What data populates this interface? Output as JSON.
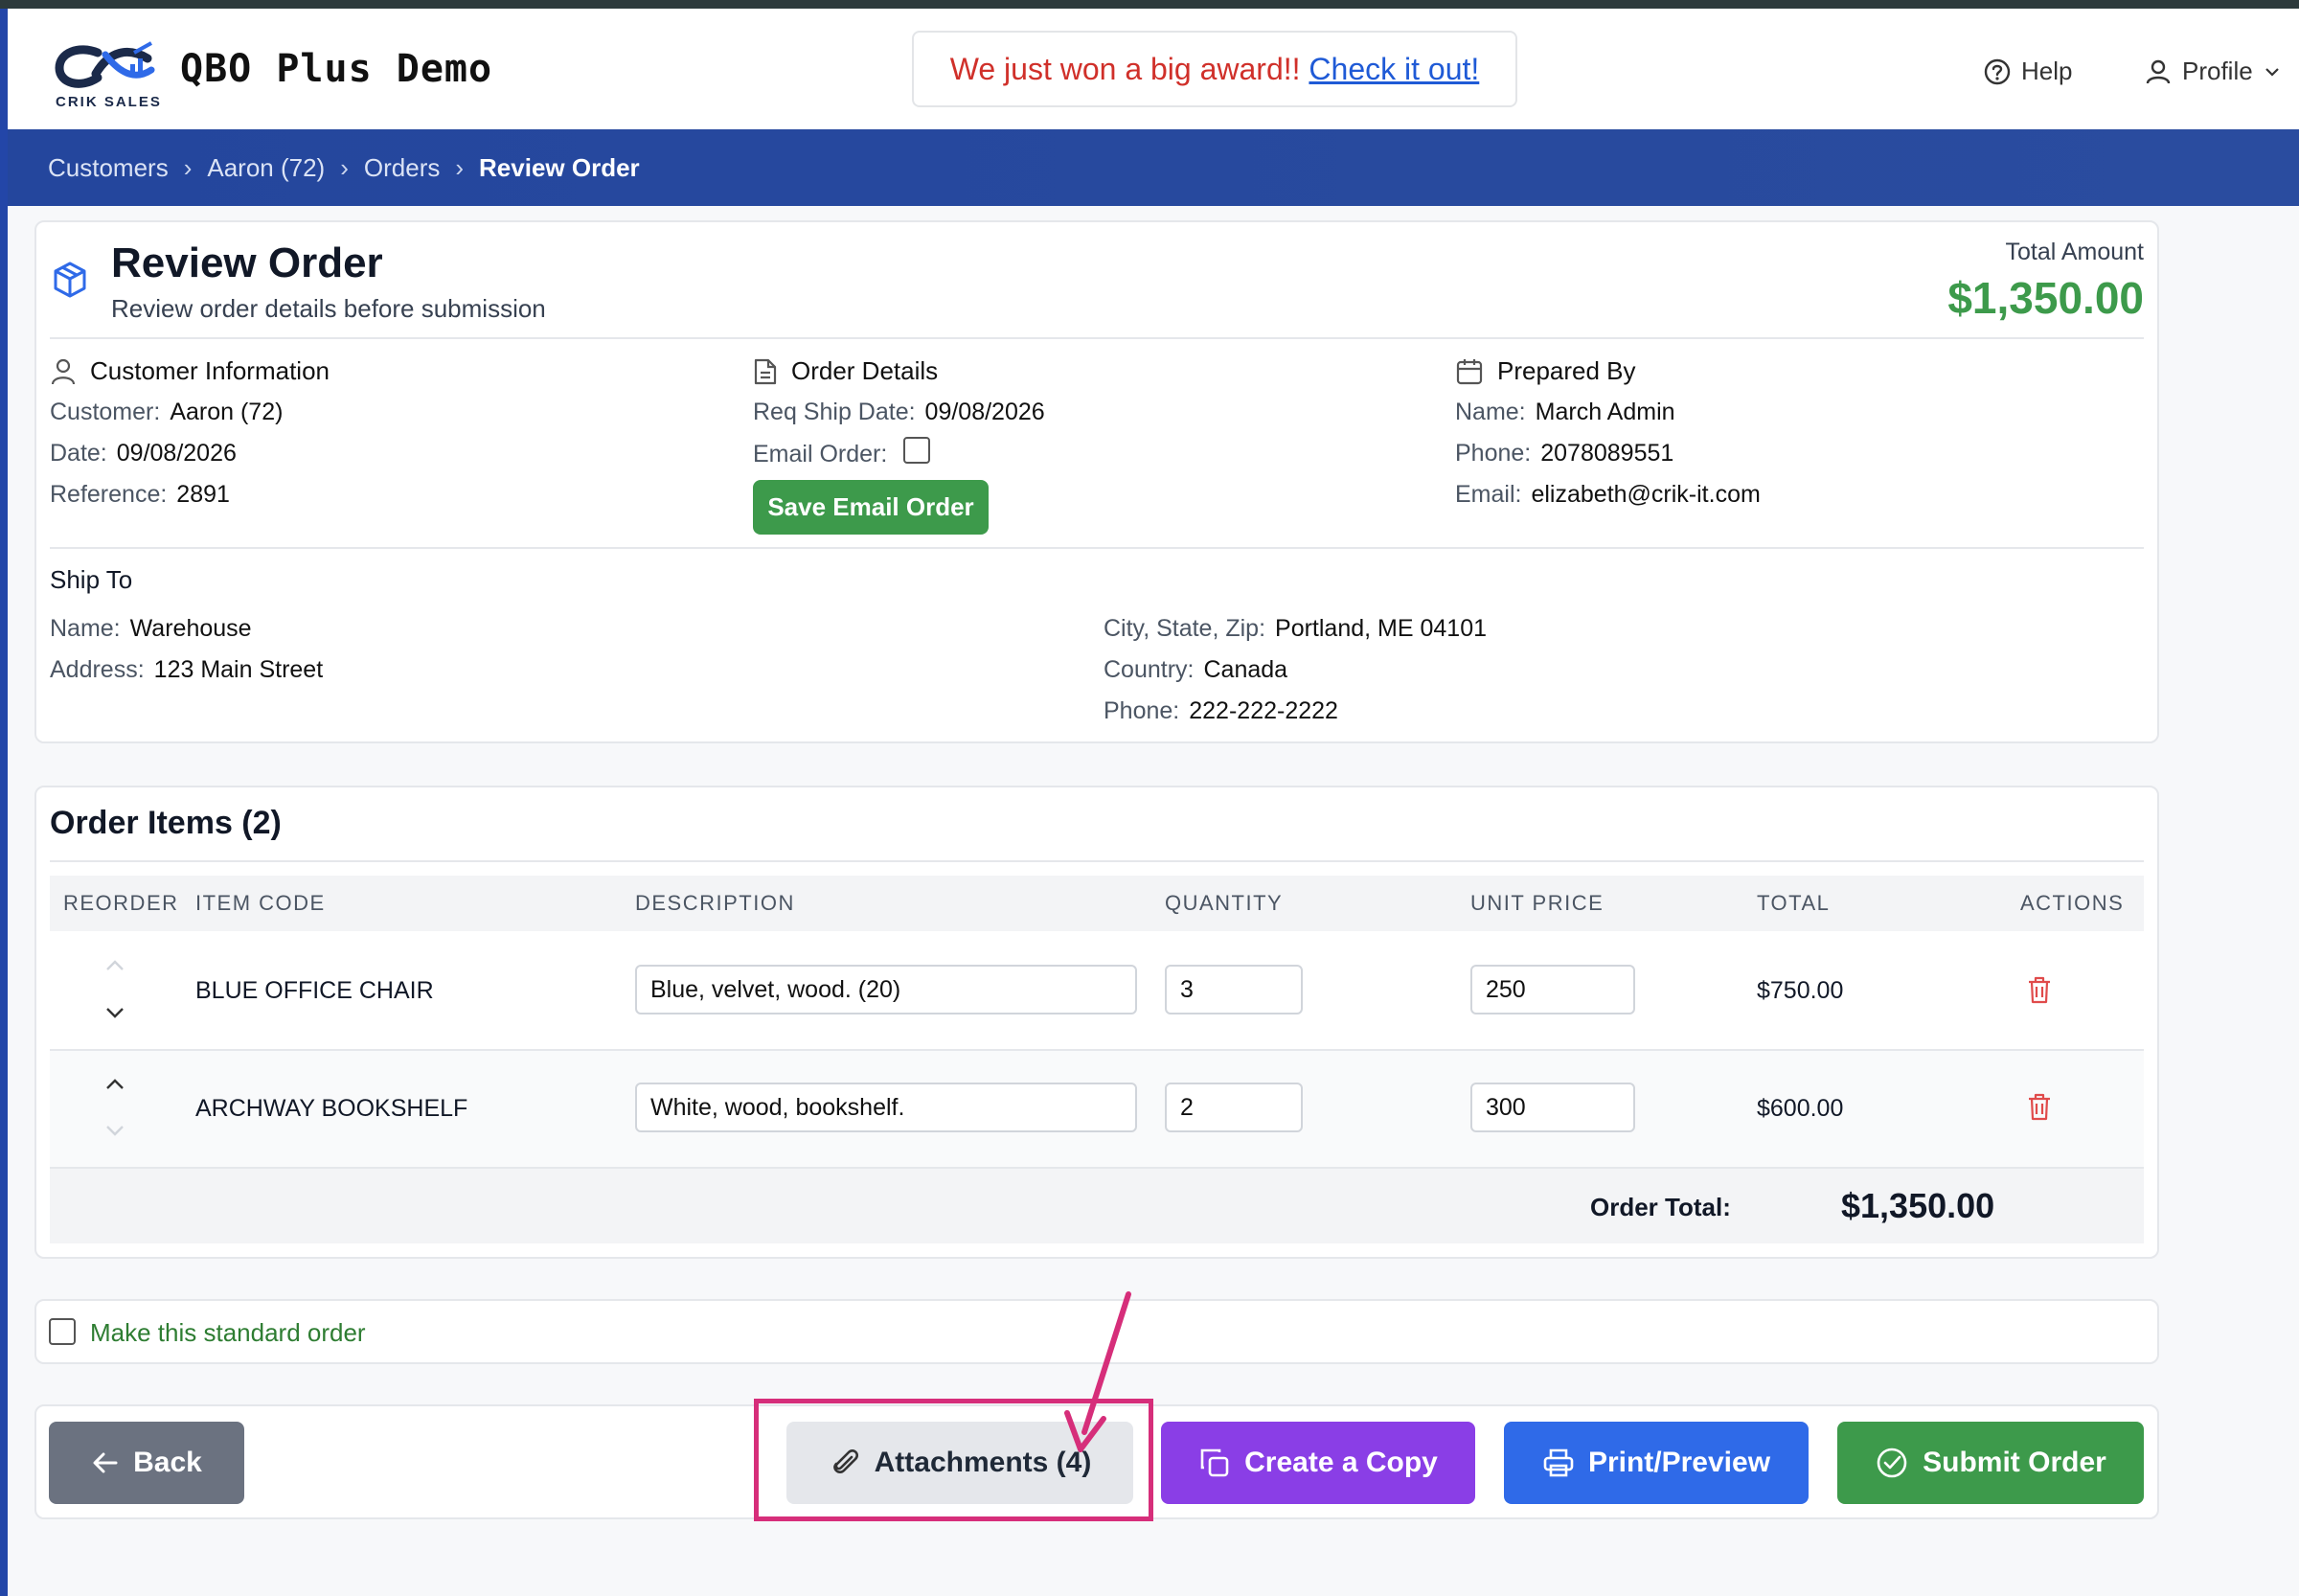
{
  "header": {
    "logo_text": "CRIK SALES",
    "brand": "QBO Plus Demo",
    "award_text": "We just won a big award!!",
    "award_link": "Check it out!",
    "help": "Help",
    "profile": "Profile"
  },
  "breadcrumb": [
    "Customers",
    "Aaron (72)",
    "Orders",
    "Review Order"
  ],
  "review": {
    "title": "Review Order",
    "subtitle": "Review order details before submission",
    "total_label": "Total Amount",
    "total_value": "$1,350.00"
  },
  "customer_info": {
    "title": "Customer Information",
    "customer_label": "Customer:",
    "customer": "Aaron (72)",
    "date_label": "Date:",
    "date": "09/08/2026",
    "reference_label": "Reference:",
    "reference": "2891"
  },
  "order_details": {
    "title": "Order Details",
    "ship_label": "Req Ship Date:",
    "ship_date": "09/08/2026",
    "email_label": "Email Order:",
    "save_email": "Save Email Order"
  },
  "prepared_by": {
    "title": "Prepared By",
    "name_label": "Name:",
    "name": "March Admin",
    "phone_label": "Phone:",
    "phone": "2078089551",
    "email_label": "Email:",
    "email": "elizabeth@crik-it.com"
  },
  "ship_to": {
    "title": "Ship To",
    "name_label": "Name:",
    "name": "Warehouse",
    "address_label": "Address:",
    "address": "123 Main Street",
    "city_label": "City, State, Zip:",
    "city": "Portland, ME 04101",
    "country_label": "Country:",
    "country": "Canada",
    "phone_label": "Phone:",
    "phone": "222-222-2222"
  },
  "items": {
    "title": "Order Items (2)",
    "columns": [
      "REORDER",
      "ITEM CODE",
      "DESCRIPTION",
      "QUANTITY",
      "UNIT PRICE",
      "TOTAL",
      "ACTIONS"
    ],
    "rows": [
      {
        "code": "BLUE OFFICE CHAIR",
        "description": "Blue, velvet, wood. (20)",
        "quantity": "3",
        "unit_price": "250",
        "total": "$750.00"
      },
      {
        "code": "ARCHWAY BOOKSHELF",
        "description": "White, wood, bookshelf.",
        "quantity": "2",
        "unit_price": "300",
        "total": "$600.00"
      }
    ],
    "order_total_label": "Order Total:",
    "order_total": "$1,350.00"
  },
  "standard_order": "Make this standard order",
  "actions": {
    "back": "Back",
    "attachments": "Attachments (4)",
    "copy": "Create a Copy",
    "print": "Print/Preview",
    "submit": "Submit Order"
  },
  "colors": {
    "nav": "#24469d",
    "green": "#3d9a4b",
    "purple": "#8a3ee6",
    "blue": "#2f6ae8",
    "gray": "#6b7280",
    "highlight": "#d62e7a"
  }
}
